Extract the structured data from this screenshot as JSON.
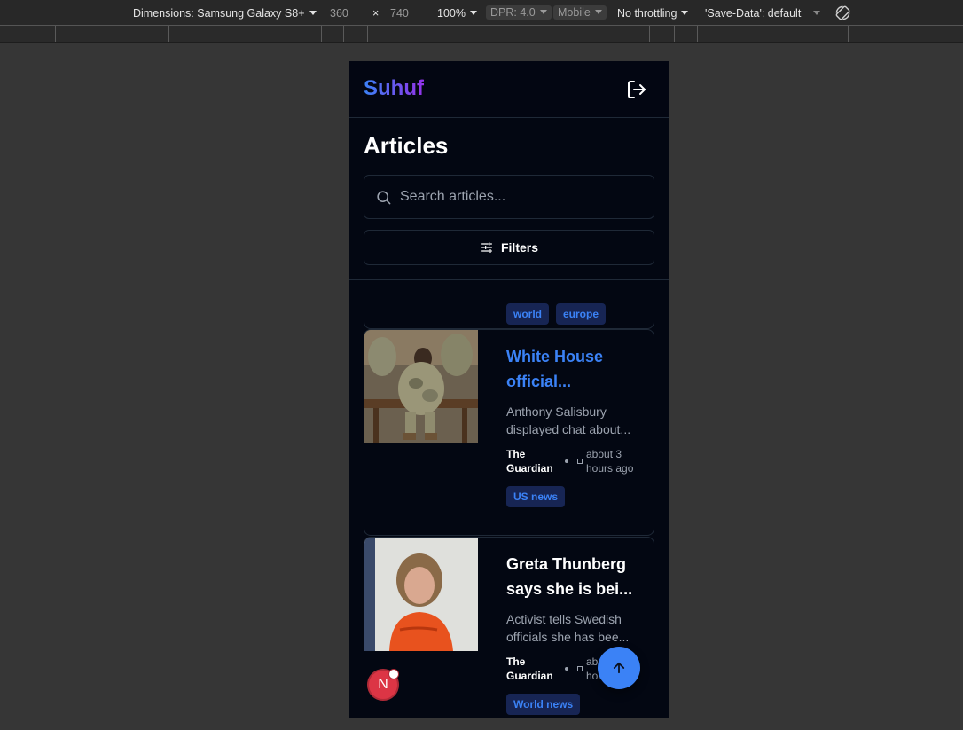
{
  "devtools": {
    "dimensions_label": "Dimensions: Samsung Galaxy S8+",
    "width": "360",
    "times": "×",
    "height": "740",
    "zoom": "100%",
    "dpr": "DPR: 4.0",
    "mode": "Mobile",
    "throttling": "No throttling",
    "save_data": "'Save-Data': default"
  },
  "app": {
    "logo": "Suhuf",
    "page_title": "Articles",
    "search_placeholder": "Search articles...",
    "filters_label": "Filters"
  },
  "partial_card": {
    "tags": [
      "world",
      "europe"
    ]
  },
  "articles": [
    {
      "title": "White House official...",
      "excerpt": "Anthony Salisbury displayed chat about...",
      "source": "The Guardian",
      "time": "about 3 hours ago",
      "tags": [
        "US news"
      ],
      "title_color": "#3b82f6"
    },
    {
      "title": "Greta Thunberg says she is bei...",
      "excerpt": "Activist tells Swedish officials she has bee...",
      "source": "The Guardian",
      "time": "about 3 hours ago",
      "tags": [
        "World news"
      ],
      "title_color": "#ffffff"
    }
  ],
  "next_badge": "N",
  "colors": {
    "background": "#030712",
    "accent": "#3b82f6",
    "tag_bg": "#172554",
    "border": "#1f2937"
  }
}
